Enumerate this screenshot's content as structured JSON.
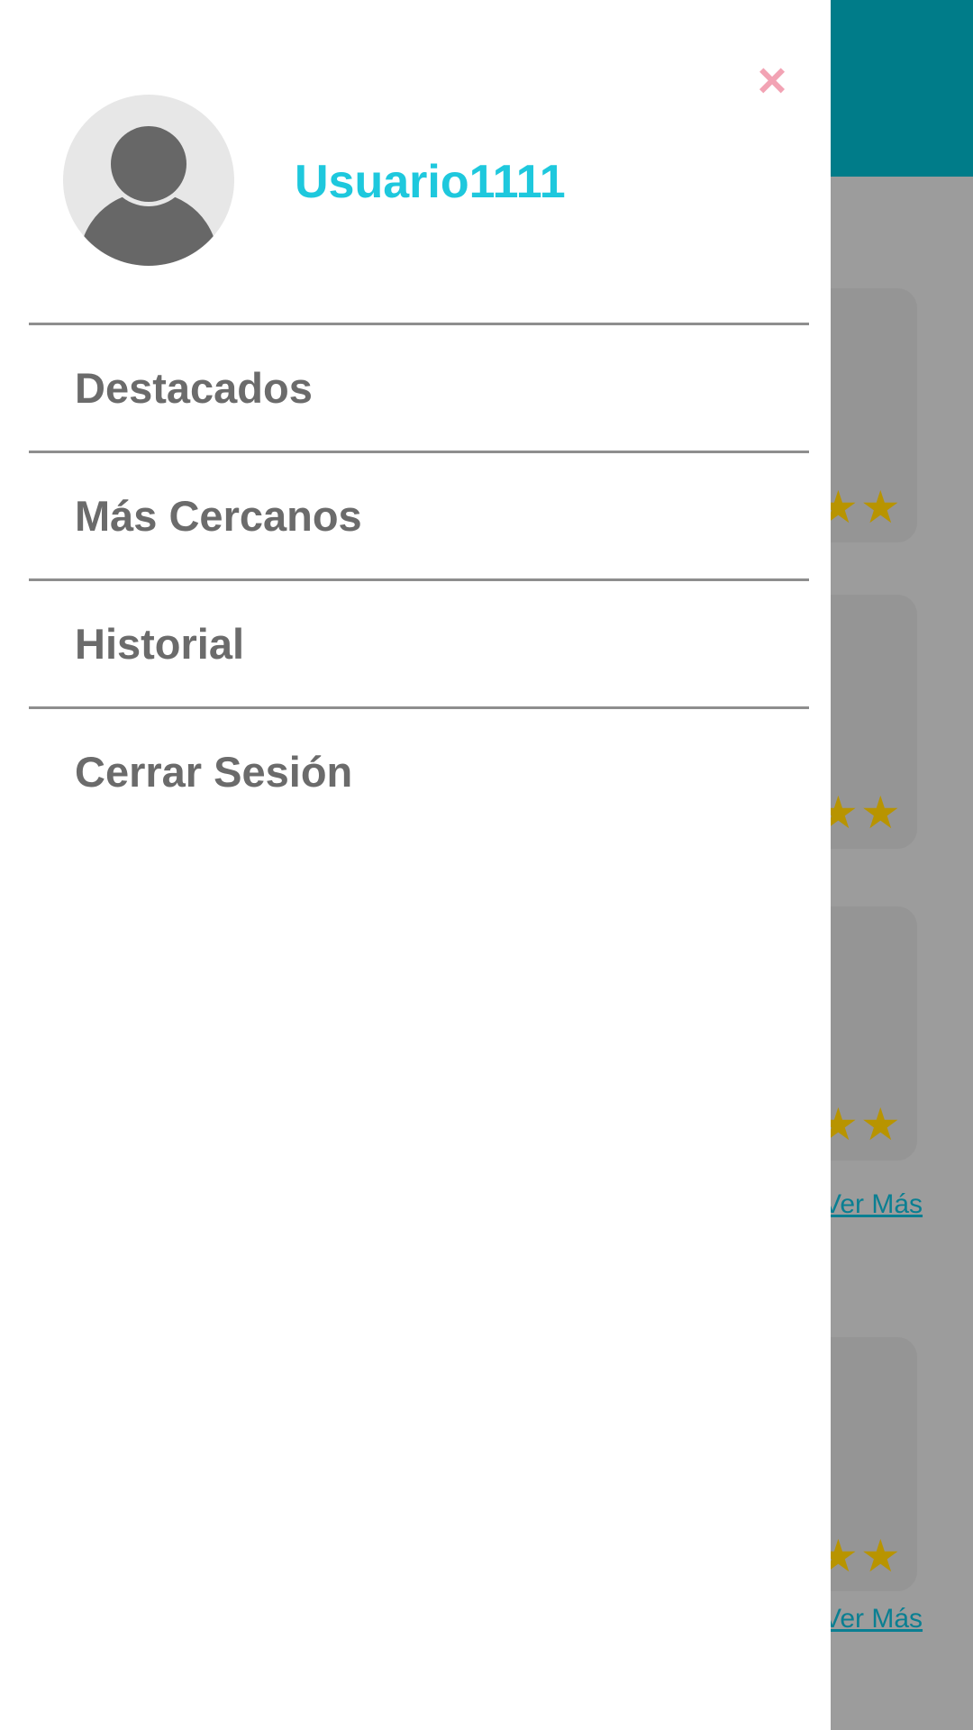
{
  "background": {
    "ver_mas_label": "Ver Más",
    "stars": "★★",
    "colors": {
      "header": "#007c89",
      "stars": "#b89400"
    }
  },
  "drawer": {
    "close_icon": "×",
    "username": "Usuario1111",
    "menu": [
      {
        "label": "Destacados"
      },
      {
        "label": "Más Cercanos"
      },
      {
        "label": "Historial"
      },
      {
        "label": "Cerrar Sesión"
      }
    ],
    "colors": {
      "username": "#1ec8dd",
      "close": "#f2a3b4",
      "menu_text": "#6b6b6b"
    }
  }
}
